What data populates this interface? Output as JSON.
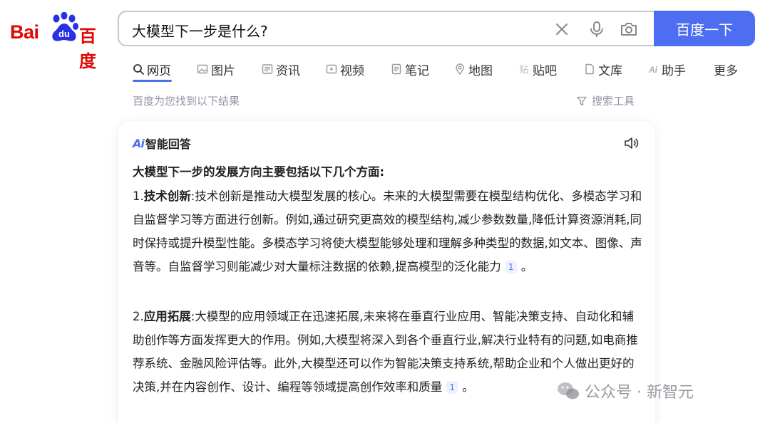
{
  "logo": {
    "latin": "Bai",
    "paw_text": "du",
    "chinese": "百度"
  },
  "search": {
    "query": "大模型下一步是什么?",
    "button_label": "百度一下"
  },
  "tabs": [
    {
      "label": "网页",
      "icon": "search-icon",
      "active": true
    },
    {
      "label": "图片",
      "icon": "image-icon"
    },
    {
      "label": "资讯",
      "icon": "news-icon"
    },
    {
      "label": "视频",
      "icon": "video-icon"
    },
    {
      "label": "笔记",
      "icon": "note-icon"
    },
    {
      "label": "地图",
      "icon": "map-pin-icon"
    },
    {
      "label": "贴吧",
      "icon": "tieba-icon"
    },
    {
      "label": "文库",
      "icon": "doc-icon"
    },
    {
      "label": "助手",
      "icon": "ai-icon"
    },
    {
      "label": "更多"
    }
  ],
  "results_meta": "百度为您找到以下结果",
  "tools_label": "搜索工具",
  "answer": {
    "ai_mark": "Ai",
    "title": "智能回答",
    "intro": "大模型下一步的发展方向主要包括以下几个方面:",
    "items": [
      {
        "num": "1.",
        "keyword": "技术创新",
        "text": ":技术创新是推动大模型发展的核心。未来的大模型需要在模型结构优化、多模态学习和自监督学习等方面进行创新。例如,通过研究更高效的模型结构,减少参数数量,降低计算资源消耗,同时保持或提升模型性能。多模态学习将使大模型能够处理和理解多种类型的数据,如文本、图像、声音等。自监督学习则能减少对大量标注数据的依赖,提高模型的泛化能力",
        "cite": "1",
        "end": "。"
      },
      {
        "num": "2.",
        "keyword": "应用拓展",
        "text": ":大模型的应用领域正在迅速拓展,未来将在垂直行业应用、智能决策支持、自动化和辅助创作等方面发挥更大的作用。例如,大模型将深入到各个垂直行业,解决行业特有的问题,如电商推荐系统、金融风险评估等。此外,大模型还可以作为智能决策支持系统,帮助企业和个人做出更好的决策,并在内容创作、设计、编程等领域提高创作效率和质量",
        "cite": "1",
        "end": "。"
      }
    ]
  },
  "watermark": "公众号 · 新智元",
  "colors": {
    "brand_red": "#e10601",
    "accent_blue": "#4e6ef2",
    "muted": "#9195a3"
  }
}
